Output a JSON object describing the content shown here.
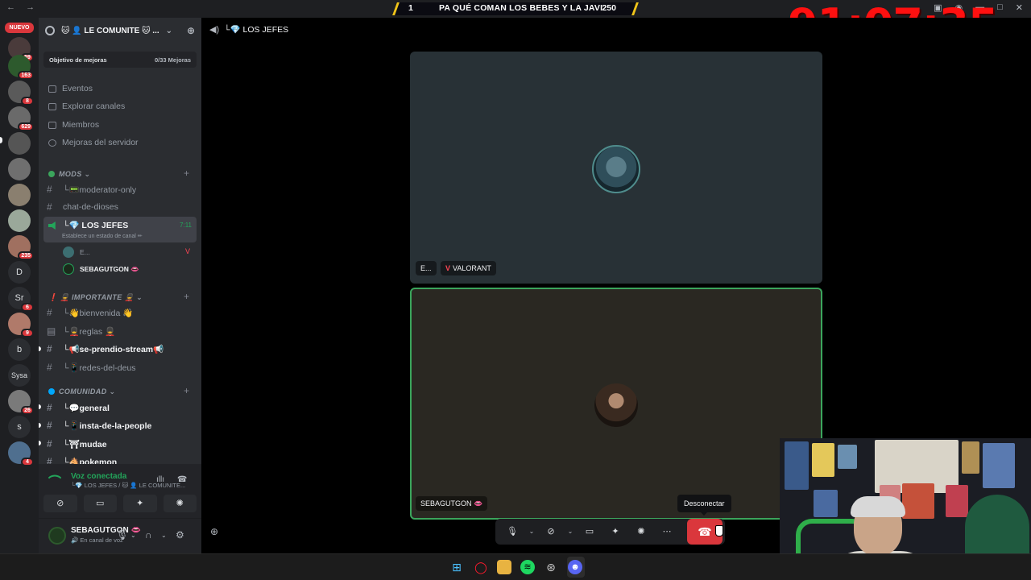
{
  "banner": {
    "left": "1",
    "title": "PA QUÉ COMAN LOS BEBES Y LA JAVI",
    "right": "250"
  },
  "timer": "91:07:35",
  "rail": {
    "nuevo": "NUEVO",
    "servers": [
      {
        "badge": "59"
      },
      {
        "badge": "163"
      },
      {
        "badge": "8"
      },
      {
        "badge": "629"
      },
      {
        "badge": ""
      },
      {
        "badge": ""
      },
      {
        "badge": ""
      },
      {
        "badge": ""
      },
      {
        "badge": "235"
      },
      {
        "label": "D",
        "badge": ""
      },
      {
        "label": "Sr",
        "badge": "6"
      },
      {
        "badge": "9"
      },
      {
        "label": "b",
        "badge": ""
      },
      {
        "label": "Sysa",
        "badge": ""
      },
      {
        "badge": "26"
      },
      {
        "label": "s",
        "badge": ""
      },
      {
        "badge": "4"
      }
    ]
  },
  "server": {
    "name": "🐱 👤 LE COMUNITE 🐱 ...",
    "boost_label": "Objetivo de mejoras",
    "boost_value": "0/33 Mejoras",
    "menu": [
      "Eventos",
      "Explorar canales",
      "Miembros",
      "Mejoras del servidor"
    ]
  },
  "categories": {
    "mods": "MODS",
    "importante": "❗ 💂 IMPORTANTE 💂",
    "comunidad": "COMUNIDAD"
  },
  "channels": {
    "moderator_only": "└📟moderator-only",
    "chat_de_dioses": "chat-de-dioses",
    "los_jefes": "└💎 LOS JEFES",
    "los_jefes_status": "Establece un estado de canal ✏",
    "los_jefes_time": "7:11",
    "voice_user1": "E...",
    "voice_user2": "SEBAGUTGON 👄",
    "bienvenida": "└👋bienvenida 👋",
    "reglas": "└💂reglas 💂",
    "se_prendio_stream": "└📢se-prendio-stream📢",
    "redes_del_deus": "└📱redes-del-deus",
    "general": "└💬general",
    "insta": "└📱insta-de-la-people",
    "mudae": "└⛩mudae",
    "pokemon": "└🐴pokemon"
  },
  "voice_panel": {
    "status": "Voz conectada",
    "channel": "└💎 LOS JEFES / 🐱 👤 LE COMUNITE..."
  },
  "user": {
    "name": "SEBAGUTGON 👄",
    "status": "🔊 En canal de voz"
  },
  "stage": {
    "channel_title": "└💎 LOS JEFES",
    "tile1_name": "E...",
    "tile1_game": "VALORANT",
    "tile2_name": "SEBAGUTGON 👄",
    "tooltip": "Desconectar"
  }
}
